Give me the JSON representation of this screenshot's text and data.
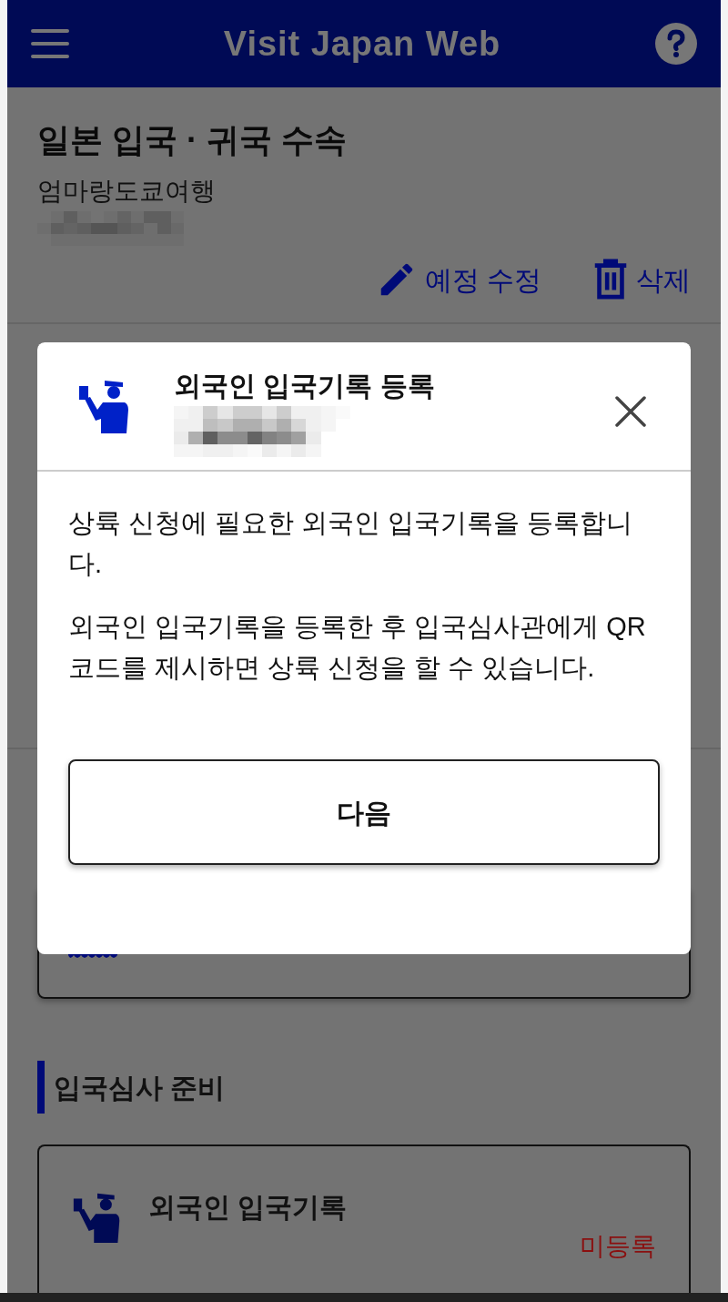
{
  "header": {
    "title": "Visit Japan Web"
  },
  "page": {
    "title": "일본 입국 · 귀국 수속",
    "trip_name": "엄마랑도쿄여행",
    "actions": [
      {
        "label": "예정 수정",
        "kind": "edit"
      },
      {
        "label": "삭제",
        "kind": "delete"
      }
    ]
  },
  "section": {
    "heading": "입국심사 준비",
    "card": {
      "title": "외국인 입국기록",
      "status": "미등록"
    }
  },
  "modal": {
    "title": "외국인 입국기록 등록",
    "paragraphs": [
      "상륙 신청에 필요한 외국인 입국기록을 등록합니다.",
      "외국인 입국기록을 등록한 후 입국심사관에게 QR 코드를 제시하면 상륙 신청을 할 수 있습니다."
    ],
    "button": "다음"
  }
}
